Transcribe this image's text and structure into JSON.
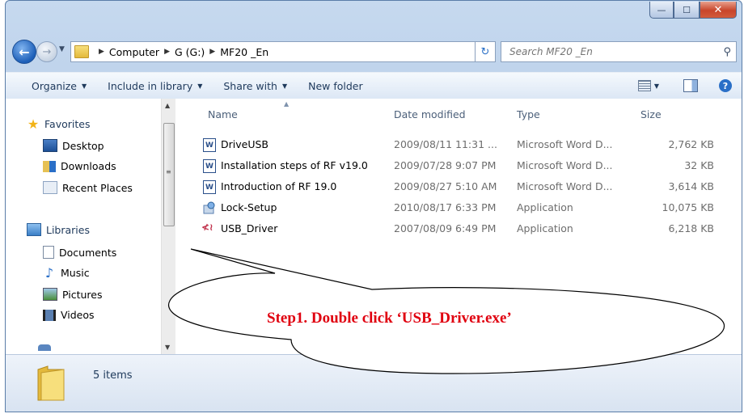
{
  "window": {
    "minimize_glyph": "—",
    "maximize_glyph": "☐",
    "close_glyph": "✕"
  },
  "navigation": {
    "breadcrumb": [
      "Computer",
      "G (G:)",
      "MF20 _En"
    ],
    "search_placeholder": "Search MF20 _En"
  },
  "toolbar": {
    "organize": "Organize",
    "include_in_library": "Include in library",
    "share_with": "Share with",
    "new_folder": "New folder"
  },
  "sidebar": {
    "favorites": {
      "label": "Favorites",
      "items": [
        "Desktop",
        "Downloads",
        "Recent Places"
      ]
    },
    "libraries": {
      "label": "Libraries",
      "items": [
        "Documents",
        "Music",
        "Pictures",
        "Videos"
      ]
    }
  },
  "file_list": {
    "columns": [
      "Name",
      "Date modified",
      "Type",
      "Size"
    ],
    "rows": [
      {
        "name": "DriveUSB",
        "date": "2009/08/11 11:31 ...",
        "type": "Microsoft Word D...",
        "size": "2,762 KB",
        "icon": "word-doc-icon"
      },
      {
        "name": "Installation steps of RF v19.0",
        "date": "2009/07/28 9:07 PM",
        "type": "Microsoft Word D...",
        "size": "32 KB",
        "icon": "word-doc-icon"
      },
      {
        "name": "Introduction of RF 19.0",
        "date": "2009/08/27 5:10 AM",
        "type": "Microsoft Word D...",
        "size": "3,614 KB",
        "icon": "word-doc-icon"
      },
      {
        "name": "Lock-Setup",
        "date": "2010/08/17 6:33 PM",
        "type": "Application",
        "size": "10,075 KB",
        "icon": "setup-app-icon"
      },
      {
        "name": "USB_Driver",
        "date": "2007/08/09 6:49 PM",
        "type": "Application",
        "size": "6,218 KB",
        "icon": "usb-driver-icon"
      }
    ]
  },
  "status": {
    "item_count": "5 items"
  },
  "annotation": {
    "text": "Step1. Double click ‘USB_Driver.exe’",
    "color": "#e0000f"
  }
}
